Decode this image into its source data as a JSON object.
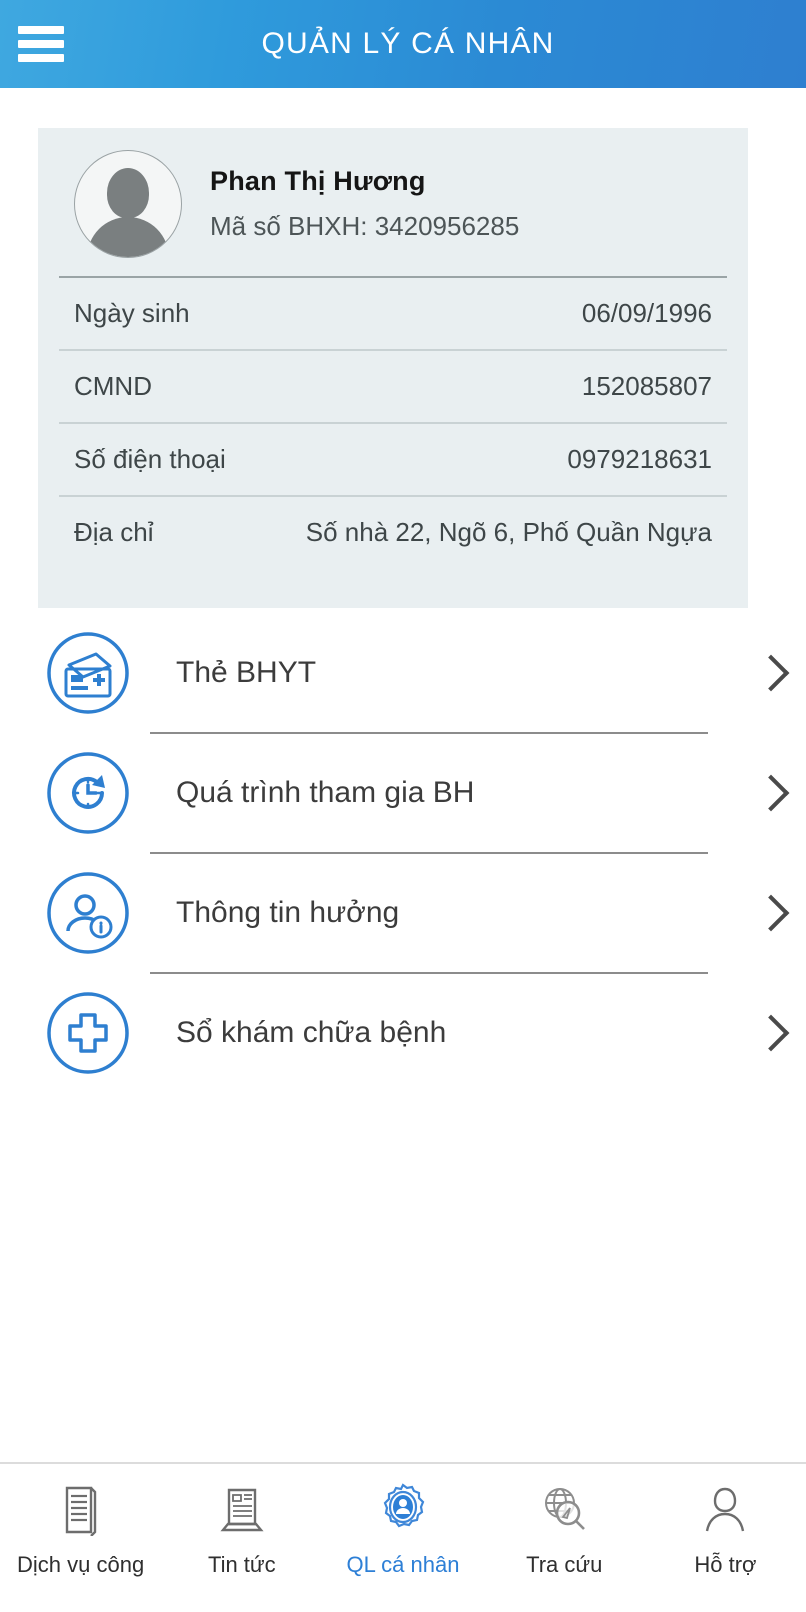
{
  "header": {
    "title": "QUẢN LÝ CÁ NHÂN",
    "menu_icon": "hamburger-menu-icon",
    "accent_start": "#3fa8e0",
    "accent_end": "#2e7fd0"
  },
  "profile": {
    "avatar_icon": "person-placeholder-avatar",
    "name": "Phan Thị Hương",
    "bhxh_line": "Mã số BHXH: 3420956285",
    "rows": [
      {
        "label": "Ngày sinh",
        "value": "06/09/1996"
      },
      {
        "label": "CMND",
        "value": "152085807"
      },
      {
        "label": "Số điện thoại",
        "value": "0979218631"
      },
      {
        "label": "Địa chỉ",
        "value": "Số nhà 22, Ngõ 6, Phố Quần Ngựa"
      }
    ],
    "card_bg": "#e9eff1"
  },
  "menu": {
    "items": [
      {
        "label": "Thẻ BHYT",
        "icon": "health-insurance-card-icon",
        "chevron": "chevron-right-icon"
      },
      {
        "label": "Quá trình tham gia BH",
        "icon": "clock-history-icon",
        "chevron": "chevron-right-icon"
      },
      {
        "label": "Thông tin hưởng",
        "icon": "person-info-icon",
        "chevron": "chevron-right-icon"
      },
      {
        "label": "Sổ khám chữa bệnh",
        "icon": "medical-cross-icon",
        "chevron": "chevron-right-icon"
      }
    ],
    "icon_color": "#2e7fd0"
  },
  "bottom_nav": {
    "active_index": 2,
    "active_color": "#2d7fd6",
    "inactive_color": "#2f2f2f",
    "items": [
      {
        "label": "Dịch vụ công",
        "icon": "document-list-icon"
      },
      {
        "label": "Tin tức",
        "icon": "newspaper-icon"
      },
      {
        "label": "QL cá nhân",
        "icon": "personal-seal-icon"
      },
      {
        "label": "Tra cứu",
        "icon": "globe-search-icon"
      },
      {
        "label": "Hỗ trợ",
        "icon": "person-support-icon"
      }
    ]
  }
}
